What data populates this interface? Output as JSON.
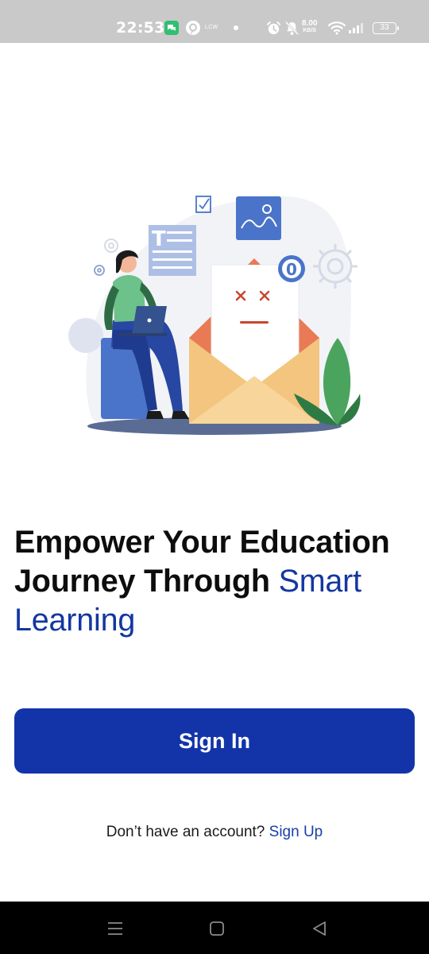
{
  "status_bar": {
    "time": "22:53",
    "carrier_text": "LCW",
    "net_speed_value": "8.00",
    "net_speed_unit": "KB/S",
    "battery": "33",
    "icons": [
      "chat-app-icon",
      "pinterest-icon",
      "notification-dot",
      "alarm-icon",
      "mute-icon",
      "wifi-icon",
      "signal-icon",
      "battery-icon"
    ]
  },
  "illustration": {
    "description_icon": "woman-with-laptop-and-envelope-illustration",
    "badge_count": "0",
    "colors": {
      "envelope": "#f1c67b",
      "envelope_flap": "#e8744a",
      "accent_blue": "#4a74c9",
      "plant": "#4aa45d"
    }
  },
  "headline": {
    "line_main": "Empower Your Education Journey Through",
    "line_accent": "Smart Learning"
  },
  "actions": {
    "signin_label": "Sign In",
    "signup_prompt": "Don’t have an account?",
    "signup_link": "Sign Up"
  },
  "nav_bar": {
    "buttons": [
      "menu-icon",
      "home-icon",
      "back-icon"
    ]
  },
  "colors": {
    "primary": "#1334a9",
    "accent_text": "#1336a2",
    "status_bar_bg": "#c9c9c9",
    "nav_bar_bg": "#000000"
  }
}
